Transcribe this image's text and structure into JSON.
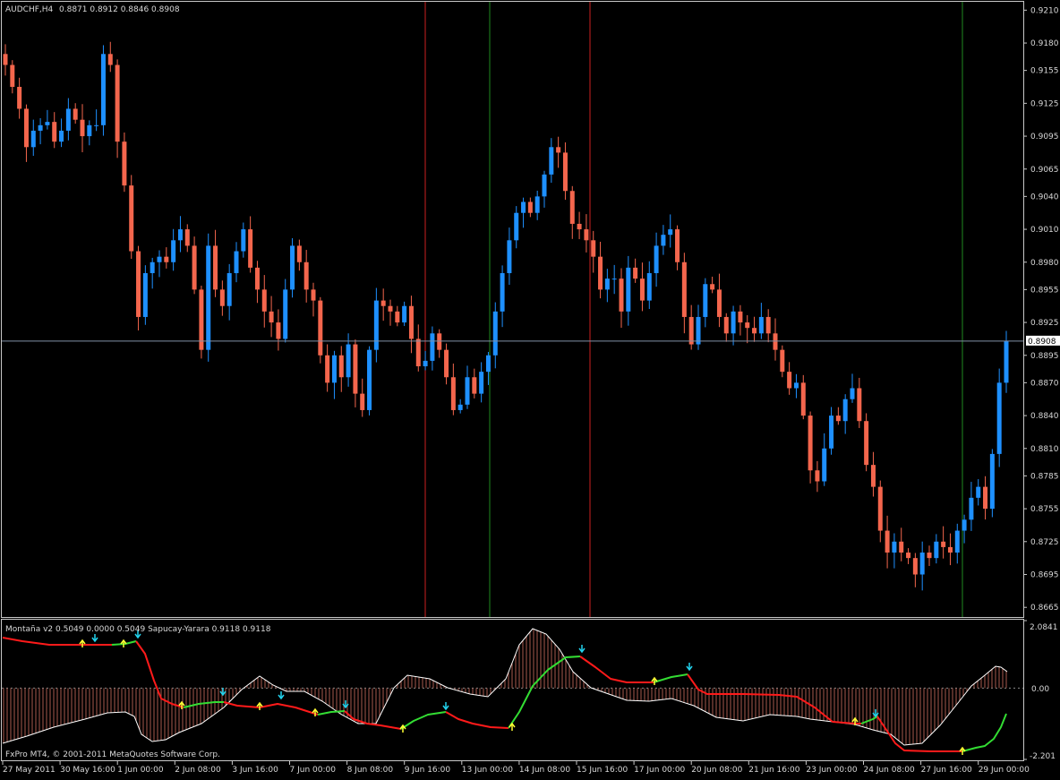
{
  "window": {
    "symbol_header": "AUDCHF,H4",
    "ohlc_header": "0.8871 0.8912 0.8846 0.8908"
  },
  "indicator": {
    "header": "Montaña v2 0.5049 0.0000 0.5049  Sapucay-Yarara 0.9118 0.9118",
    "scale_labels": [
      "2.0841",
      "0.00",
      "-2.201"
    ]
  },
  "copyright": "FxPro MT4, © 2001-2011 MetaQuotes Software Corp.",
  "colors": {
    "background": "#000000",
    "bull_candle": "#1e90ff",
    "bear_candle": "#f4664d",
    "frame": "#c8c8c8",
    "vline_red": "#cc2020",
    "vline_green": "#1f8a1f",
    "hline": "#7f8fa6",
    "line_red": "#ff1a1a",
    "line_green": "#33dd33",
    "osc_white": "#ffffff",
    "up_arrow": "#ffff33",
    "down_arrow": "#22d3ee"
  },
  "chart_data": {
    "type": "candlestick",
    "symbol": "AUDCHF",
    "timeframe": "H4",
    "ylim": [
      0.8657,
      0.9216
    ],
    "price_ticks": [
      "0.9210",
      "0.9180",
      "0.9155",
      "0.9125",
      "0.9095",
      "0.9065",
      "0.9040",
      "0.9010",
      "0.8980",
      "0.8955",
      "0.8925",
      "0.8895",
      "0.8870",
      "0.8840",
      "0.8810",
      "0.8785",
      "0.8755",
      "0.8725",
      "0.8695",
      "0.8665"
    ],
    "current_price": "0.8908",
    "time_labels": [
      "27 May 2011",
      "30 May 16:00",
      "1 Jun 00:00",
      "2 Jun 08:00",
      "3 Jun 16:00",
      "7 Jun 00:00",
      "8 Jun 08:00",
      "9 Jun 16:00",
      "13 Jun 00:00",
      "14 Jun 08:00",
      "15 Jun 16:00",
      "17 Jun 00:00",
      "20 Jun 08:00",
      "21 Jun 16:00",
      "23 Jun 00:00",
      "24 Jun 08:00",
      "27 Jun 16:00",
      "29 Jun 00:00"
    ],
    "close_path": [
      0.916,
      0.914,
      0.912,
      0.9085,
      0.91,
      0.9105,
      0.9108,
      0.909,
      0.91,
      0.912,
      0.911,
      0.9095,
      0.9105,
      0.9105,
      0.917,
      0.916,
      0.909,
      0.905,
      0.899,
      0.893,
      0.897,
      0.898,
      0.8985,
      0.898,
      0.9,
      0.901,
      0.8995,
      0.8955,
      0.89,
      0.8995,
      0.8955,
      0.894,
      0.897,
      0.899,
      0.901,
      0.8975,
      0.8955,
      0.8935,
      0.8925,
      0.891,
      0.8955,
      0.8995,
      0.898,
      0.8955,
      0.8945,
      0.8895,
      0.887,
      0.8895,
      0.8875,
      0.8905,
      0.886,
      0.8845,
      0.89,
      0.8945,
      0.894,
      0.8935,
      0.8925,
      0.894,
      0.891,
      0.8885,
      0.889,
      0.8915,
      0.89,
      0.8875,
      0.8845,
      0.885,
      0.8875,
      0.886,
      0.888,
      0.8895,
      0.8935,
      0.897,
      0.9,
      0.9025,
      0.9035,
      0.9025,
      0.904,
      0.906,
      0.9085,
      0.908,
      0.9045,
      0.9015,
      0.901,
      0.9,
      0.8985,
      0.8955,
      0.8965,
      0.8965,
      0.8935,
      0.8975,
      0.8965,
      0.8945,
      0.897,
      0.8995,
      0.9005,
      0.901,
      0.898,
      0.893,
      0.8905,
      0.893,
      0.896,
      0.8955,
      0.893,
      0.8915,
      0.8935,
      0.8925,
      0.892,
      0.8915,
      0.893,
      0.8915,
      0.89,
      0.888,
      0.8865,
      0.887,
      0.884,
      0.879,
      0.878,
      0.881,
      0.884,
      0.8835,
      0.8855,
      0.8865,
      0.8835,
      0.8795,
      0.8775,
      0.8735,
      0.8715,
      0.8725,
      0.8715,
      0.871,
      0.8695,
      0.8715,
      0.871,
      0.8725,
      0.872,
      0.8715,
      0.8735,
      0.8745,
      0.8765,
      0.8775,
      0.8755,
      0.8805,
      0.887,
      0.8908
    ],
    "vertical_markers": [
      {
        "label": "red-line-1",
        "color": "red",
        "time": "10 Jun"
      },
      {
        "label": "green-line-1",
        "color": "green",
        "time": "13 Jun"
      },
      {
        "label": "red-line-2",
        "color": "red",
        "time": "15 Jun"
      },
      {
        "label": "green-line-2",
        "color": "green",
        "time": "28 Jun"
      }
    ],
    "subwindow": {
      "series": [
        {
          "name": "Montaña v2",
          "values": [
            0.5049
          ]
        },
        {
          "name": "Sapucay-Yarara",
          "values": [
            0.9118
          ]
        }
      ],
      "ylim": [
        -2.201,
        2.0841
      ]
    }
  }
}
